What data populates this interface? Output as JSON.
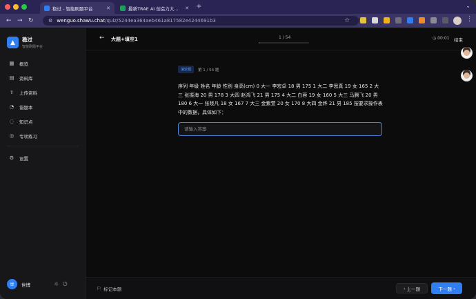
{
  "browser": {
    "tabs": [
      {
        "title": "稳过 - 智能刷题平台",
        "favicon_color": "#2f7ef2",
        "active": true
      },
      {
        "title": "最新TRAE AI 创造力大赛/【大…",
        "favicon_color": "#1e9e5a",
        "active": false
      }
    ],
    "new_tab": "+",
    "url_host": "wenguo.shawu.chat",
    "url_path": "/quiz/5244ea364aeb461a817582e4244691b3"
  },
  "app": {
    "brand_name": "稳过",
    "brand_sub": "智能刷题平台",
    "menu": [
      {
        "label": "概览",
        "icon": "grid-icon"
      },
      {
        "label": "资料库",
        "icon": "book-icon"
      },
      {
        "label": "上传资料",
        "icon": "upload-icon"
      },
      {
        "label": "错题本",
        "icon": "alert-icon"
      },
      {
        "label": "知识点",
        "icon": "bulb-icon"
      },
      {
        "label": "专项练习",
        "icon": "target-icon"
      }
    ],
    "settings_label": "设置",
    "user_name": "世博",
    "user_initial": "世"
  },
  "quiz": {
    "back": "←",
    "title": "大题+填空1",
    "progress_text": "1 / 54",
    "progress_fraction": 0.0185,
    "timer": "00:01",
    "end_label": "结束",
    "question_type": "填空题",
    "question_index": "第 1 / 54 题",
    "question_text": "序列 年级 姓名 年龄 性别 身高(cm) 0 大一 李宏卓 18 男 175 1 大二 李思真 19 女 165 2 大三 张振海 20 男 178 3 大四 赵鸿飞 21 男 175 4 大二 白蓉 19 女 160 5 大三 马腾飞 20 男 180 6 大一 张晓凡 18 女 167 7 大三 金紫萱 20 女 170 8 大四 金烨 21 男 185 按要求操作表中的数据，具体如下：",
    "answer_placeholder": "请输入答案",
    "flag_label": "标记本题",
    "prev_label": "上一题",
    "next_label": "下一题"
  },
  "colors": {
    "accent": "#2f7ef2",
    "browser_chrome": "#3b3566"
  }
}
